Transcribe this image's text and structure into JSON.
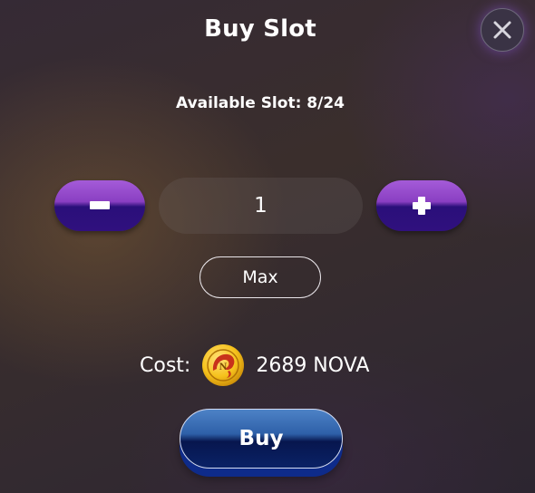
{
  "dialog": {
    "title": "Buy Slot",
    "available_label": "Available Slot: 8/24"
  },
  "stepper": {
    "decrement_icon": "minus-icon",
    "increment_icon": "plus-icon",
    "quantity": "1"
  },
  "max_button": {
    "label": "Max"
  },
  "cost": {
    "label": "Cost:",
    "coin_icon": "nova-coin-icon",
    "amount": "2689 NOVA"
  },
  "buy_button": {
    "label": "Buy"
  },
  "close_button": {
    "icon": "close-icon"
  },
  "colors": {
    "stepper_top": "#a45bd8",
    "stepper_bottom": "#2a0f7a",
    "buy_top": "#4d82c6",
    "buy_bottom": "#07164e",
    "buy_shadow": "#0e2b8a",
    "coin_gold": "#f6c21c"
  }
}
